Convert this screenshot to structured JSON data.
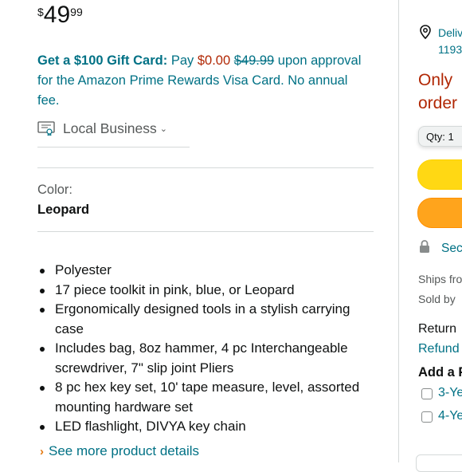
{
  "price": {
    "symbol": "$",
    "whole": "49",
    "fraction": "99"
  },
  "promo": {
    "lead": "Get a $100 Gift Card:",
    "pay": " Pay ",
    "amount": "$0.00",
    "original": "$49.99",
    "rest": " upon approval for the Amazon Prime Rewards Visa Card. No annual fee."
  },
  "business": {
    "label": "Local Business",
    "icon": "certificate-icon"
  },
  "color": {
    "label": "Color:",
    "value": "Leopard"
  },
  "bullets": [
    "Polyester",
    "17 piece toolkit in pink, blue, or Leopard",
    "Ergonomically designed tools in a stylish carrying case",
    "Includes bag, 8oz hammer, 4 pc Interchangeable screwdriver, 7\" slip joint Pliers",
    "8 pc hex key set, 10' tape measure, level, assorted mounting hardware set",
    "LED flashlight, DIVYA key chain"
  ],
  "see_more": "See more product details",
  "buybox": {
    "deliver_line1": "Deliv",
    "deliver_line2": "1193",
    "only_line1": "Only ",
    "only_line2": "order",
    "qty_label": "Qty: 1",
    "secure": "Sec",
    "ships_from": "Ships fro",
    "sold_by": "Sold by",
    "return": "Return",
    "refund": "Refund",
    "add_protection": "Add a P",
    "option1": "3-Ye",
    "option2": "4-Ye"
  },
  "colors": {
    "link": "#007185",
    "price_red": "#b12704",
    "cart_yellow": "#ffd814",
    "buy_orange": "#ffa41c"
  }
}
